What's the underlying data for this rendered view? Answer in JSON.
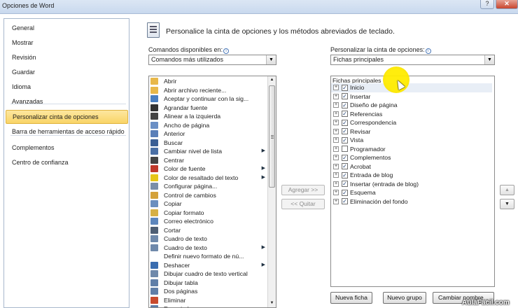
{
  "window": {
    "title": "Opciones de Word",
    "help_glyph": "?",
    "close_glyph": "✕"
  },
  "nav": [
    {
      "label": "General"
    },
    {
      "label": "Mostrar"
    },
    {
      "label": "Revisión"
    },
    {
      "label": "Guardar"
    },
    {
      "label": "Idioma"
    },
    {
      "label": "Avanzadas"
    },
    {
      "label": "Personalizar cinta de opciones",
      "selected": true
    },
    {
      "label": "Barra de herramientas de acceso rápido"
    },
    {
      "label": "Complementos"
    },
    {
      "label": "Centro de confianza"
    }
  ],
  "header": {
    "text": "Personalice la cinta de opciones y los métodos abreviados de teclado."
  },
  "left_panel": {
    "label": "Comandos disponibles en:",
    "selected": "Comandos más utilizados",
    "commands": [
      {
        "label": "Abrir",
        "icon": "open-folder-icon",
        "color": "#e8b84a"
      },
      {
        "label": "Abrir archivo reciente...",
        "icon": "recent-file-icon",
        "color": "#e8b84a"
      },
      {
        "label": "Aceptar y continuar con la sig...",
        "icon": "accept-change-icon",
        "color": "#4a7fc1"
      },
      {
        "label": "Agrandar fuente",
        "icon": "grow-font-icon",
        "color": "#333333"
      },
      {
        "label": "Alinear a la izquierda",
        "icon": "align-left-icon",
        "color": "#444444"
      },
      {
        "label": "Ancho de página",
        "icon": "page-width-icon",
        "color": "#6a8fc5"
      },
      {
        "label": "Anterior",
        "icon": "previous-icon",
        "color": "#5a7fb8"
      },
      {
        "label": "Buscar",
        "icon": "binoculars-icon",
        "color": "#3b5f95"
      },
      {
        "label": "Cambiar nivel de lista",
        "icon": "list-level-icon",
        "color": "#4a6fa5",
        "submenu": true
      },
      {
        "label": "Centrar",
        "icon": "align-center-icon",
        "color": "#444444"
      },
      {
        "label": "Color de fuente",
        "icon": "font-color-icon",
        "color": "#c0392b",
        "submenu": true
      },
      {
        "label": "Color de resaltado del texto",
        "icon": "highlight-icon",
        "color": "#e6c619",
        "submenu": true
      },
      {
        "label": "Configurar página...",
        "icon": "page-setup-icon",
        "color": "#7a8ea8"
      },
      {
        "label": "Control de cambios",
        "icon": "track-changes-icon",
        "color": "#d4a23a"
      },
      {
        "label": "Copiar",
        "icon": "copy-icon",
        "color": "#6b8fbf"
      },
      {
        "label": "Copiar formato",
        "icon": "format-painter-icon",
        "color": "#d7b045"
      },
      {
        "label": "Correo electrónico",
        "icon": "email-icon",
        "color": "#5d86bd"
      },
      {
        "label": "Cortar",
        "icon": "scissors-icon",
        "color": "#4e5e74"
      },
      {
        "label": "Cuadro de texto",
        "icon": "text-box-icon",
        "color": "#6f89ab"
      },
      {
        "label": "Cuadro de texto",
        "icon": "text-box-icon",
        "color": "#6f89ab",
        "submenu": true
      },
      {
        "label": "Definir nuevo formato de nú...",
        "icon": "",
        "color": ""
      },
      {
        "label": "Deshacer",
        "icon": "undo-icon",
        "color": "#3a6db0",
        "submenu": true
      },
      {
        "label": "Dibujar cuadro de texto vertical",
        "icon": "vertical-text-box-icon",
        "color": "#6f89ab"
      },
      {
        "label": "Dibujar tabla",
        "icon": "draw-table-icon",
        "color": "#5f7ea8"
      },
      {
        "label": "Dos páginas",
        "icon": "two-pages-icon",
        "color": "#5f7ea8"
      },
      {
        "label": "Eliminar",
        "icon": "delete-icon",
        "color": "#c84a2e"
      },
      {
        "label": "Espaciado...",
        "icon": "spacing-icon",
        "color": "#5f7ea8"
      }
    ]
  },
  "right_panel": {
    "label": "Personalizar la cinta de opciones:",
    "selected": "Fichas principales",
    "tree_header": "Fichas principales",
    "tabs": [
      {
        "label": "Inicio",
        "checked": true
      },
      {
        "label": "Insertar",
        "checked": true
      },
      {
        "label": "Diseño de página",
        "checked": true
      },
      {
        "label": "Referencias",
        "checked": true
      },
      {
        "label": "Correspondencia",
        "checked": true
      },
      {
        "label": "Revisar",
        "checked": true
      },
      {
        "label": "Vista",
        "checked": true
      },
      {
        "label": "Programador",
        "checked": false
      },
      {
        "label": "Complementos",
        "checked": true
      },
      {
        "label": "Acrobat",
        "checked": true
      },
      {
        "label": "Entrada de blog",
        "checked": true
      },
      {
        "label": "Insertar (entrada de blog)",
        "checked": true
      },
      {
        "label": "Esquema",
        "checked": true
      },
      {
        "label": "Eliminación del fondo",
        "checked": true
      }
    ]
  },
  "buttons": {
    "add": "Agregar >>",
    "remove": "<< Quitar",
    "new_tab": "Nueva ficha",
    "new_group": "Nuevo grupo",
    "rename": "Cambiar nombre..."
  },
  "glyphs": {
    "dropdown": "▼",
    "up": "▲",
    "down": "▼",
    "submenu": "▶",
    "check": "✓",
    "plus": "+",
    "info": "i"
  },
  "watermark": "AulaFacil.com",
  "accent": {
    "selected_nav": "#f9d466",
    "cursor_highlight": "#ffec00"
  }
}
